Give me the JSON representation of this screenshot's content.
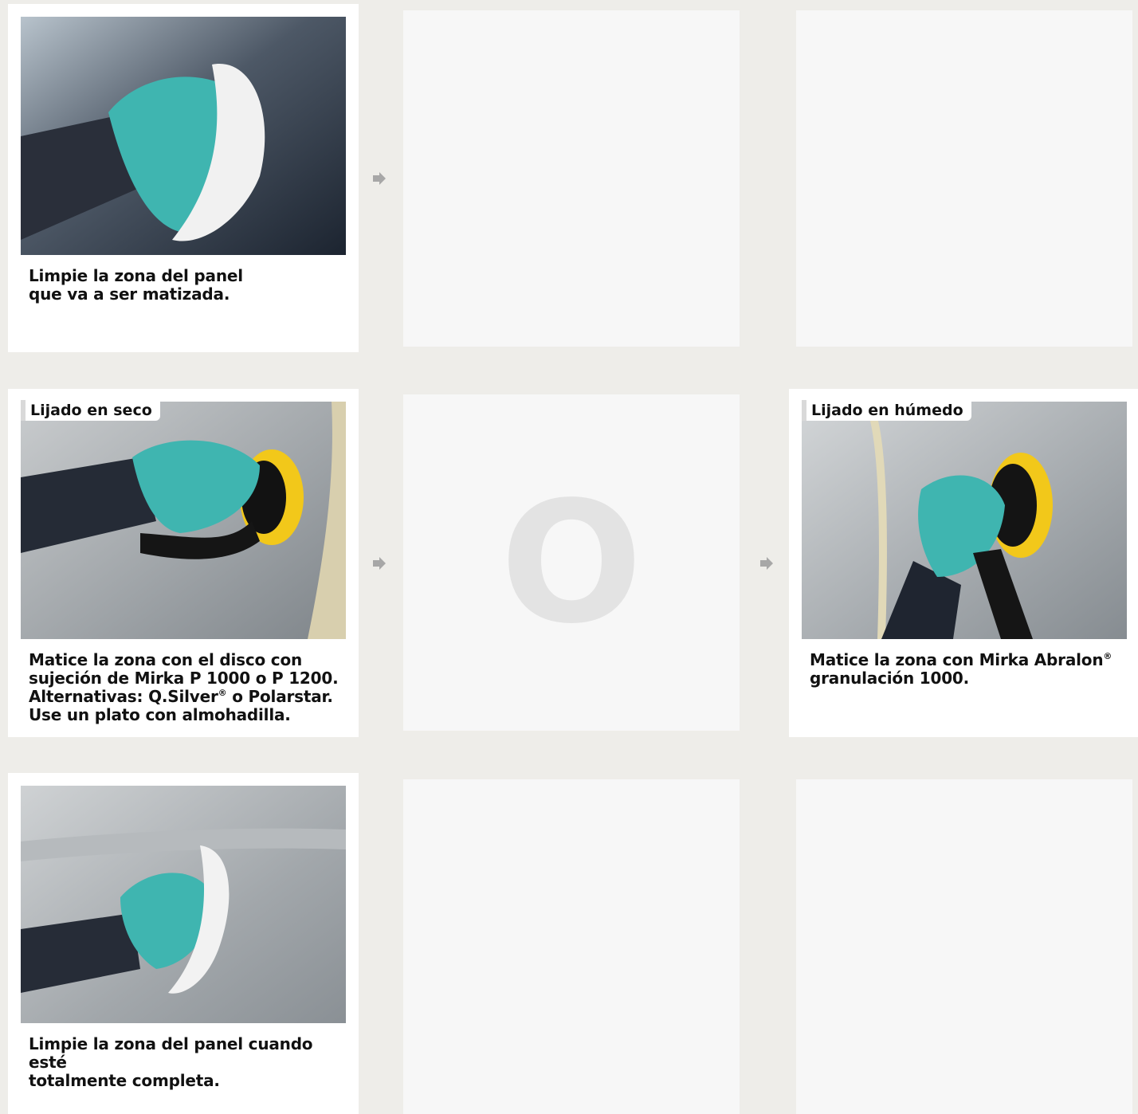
{
  "steps": [
    {
      "caption_lines": [
        "Limpie la zona del panel",
        "que va a ser matizada."
      ],
      "photo": "wiping-panel-with-cloth"
    },
    {
      "tag": "Lijado en seco",
      "caption_parts": [
        "Matice la zona con el disco con sujeción de Mirka P 1000 o P 1200. Alternativas: Q.Silver",
        "®",
        " o Polarstar. Use un plato con almohadilla."
      ],
      "photo": "dry-sanding-with-orbital-sander"
    },
    {
      "divider": "O"
    },
    {
      "tag": "Lijado en húmedo",
      "caption_parts": [
        "Matice la zona con Mirka Abralon",
        "®",
        " granulación 1000."
      ],
      "photo": "wet-sanding-with-orbital-sander"
    },
    {
      "caption_lines": [
        "Limpie la zona del panel cuando esté",
        "totalmente completa."
      ],
      "photo": "wiping-finished-panel"
    }
  ],
  "colors": {
    "background": "#eeede9",
    "card": "#ffffff",
    "placeholder": "#f7f7f7",
    "glove": "#3fb5b0",
    "sander_pad": "#f2c81a",
    "arrow": "#a7a7a7"
  },
  "icons": [
    "arrow-right-icon"
  ]
}
